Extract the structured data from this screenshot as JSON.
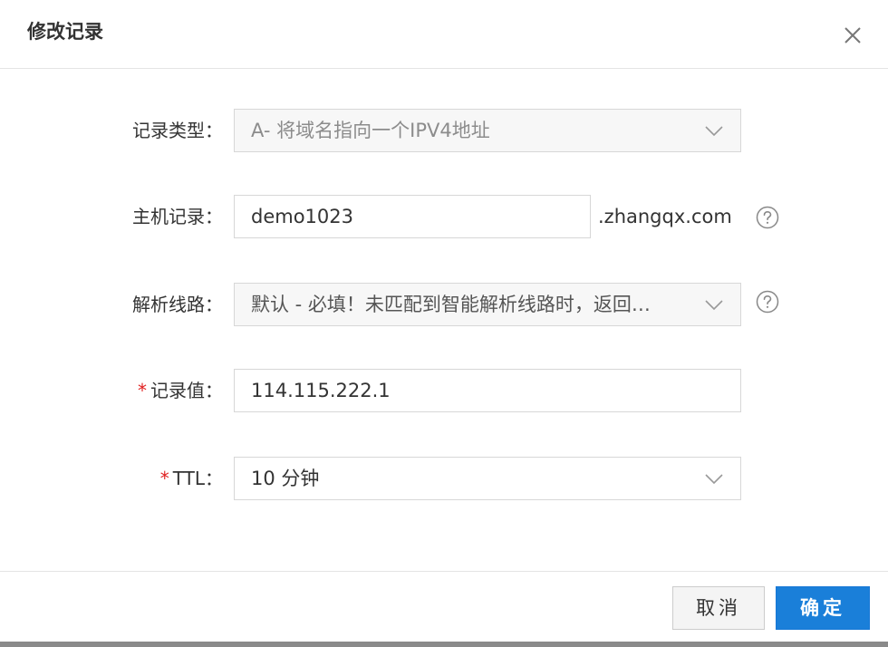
{
  "dialog": {
    "title": "修改记录",
    "close_icon": "close-icon"
  },
  "form": {
    "record_type": {
      "label": "记录类型：",
      "value": "A- 将域名指向一个IPV4地址"
    },
    "host": {
      "label": "主机记录：",
      "value": "demo1023",
      "suffix": ".zhangqx.com",
      "help_icon": "question-circle-icon"
    },
    "line": {
      "label": "解析线路：",
      "value": "默认 - 必填！未匹配到智能解析线路时，返回…",
      "help_icon": "question-circle-icon"
    },
    "record_value": {
      "required_mark": "*",
      "label": "记录值：",
      "value": "114.115.222.1"
    },
    "ttl": {
      "required_mark": "*",
      "label": "TTL：",
      "value": "10 分钟"
    }
  },
  "footer": {
    "cancel_label": "取消",
    "ok_label": "确定"
  },
  "colors": {
    "primary": "#1a7fd9",
    "required": "#e02020",
    "border": "#d7d7d7"
  }
}
